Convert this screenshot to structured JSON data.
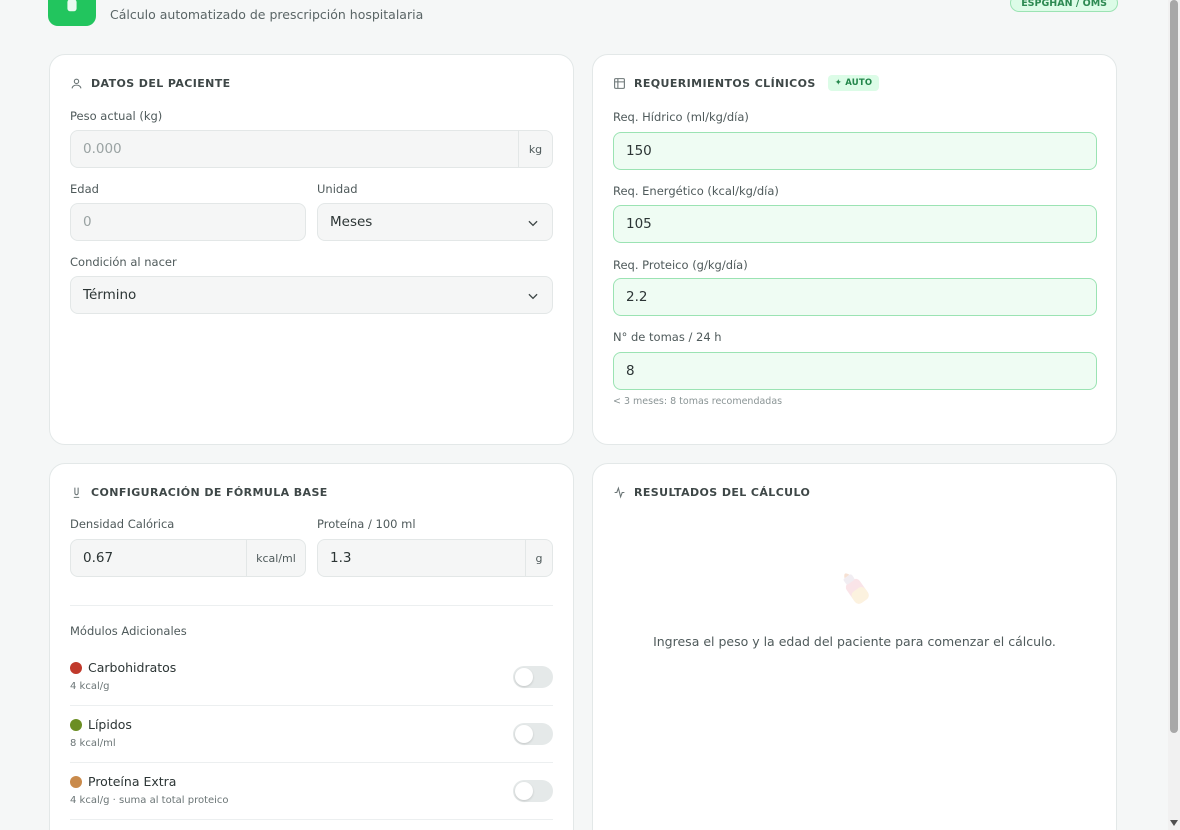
{
  "header": {
    "subtitle": "Cálculo automatizado de prescripción hospitalaria",
    "badge": "ESPGHAN / OMS"
  },
  "patient": {
    "title": "DATOS DEL PACIENTE",
    "weight_label": "Peso actual (kg)",
    "weight_placeholder": "0.000",
    "weight_unit": "kg",
    "age_label": "Edad",
    "age_placeholder": "0",
    "unit_label": "Unidad",
    "unit_value": "Meses",
    "birth_label": "Condición al nacer",
    "birth_value": "Término"
  },
  "requirements": {
    "title": "REQUERIMIENTOS CLÍNICOS",
    "auto_badge": "✦ AUTO",
    "hydric_label": "Req. Hídrico (ml/kg/día)",
    "hydric_value": "150",
    "energy_label": "Req. Energético (kcal/kg/día)",
    "energy_value": "105",
    "protein_label": "Req. Proteico (g/kg/día)",
    "protein_value": "2.2",
    "feeds_label": "N° de tomas / 24 h",
    "feeds_value": "8",
    "feeds_hint": "< 3 meses: 8 tomas recomendadas"
  },
  "formula": {
    "title": "CONFIGURACIÓN DE FÓRMULA BASE",
    "density_label": "Densidad Calórica",
    "density_value": "0.67",
    "density_unit": "kcal/ml",
    "protein_label": "Proteína / 100 ml",
    "protein_value": "1.3",
    "protein_unit": "g",
    "modules_label": "Módulos Adicionales",
    "modules": [
      {
        "name": "Carbohidratos",
        "sub": "4 kcal/g",
        "color": "#c0392b",
        "enabled": false
      },
      {
        "name": "Lípidos",
        "sub": "8 kcal/ml",
        "color": "#6b8e23",
        "enabled": false
      },
      {
        "name": "Proteína Extra",
        "sub": "4 kcal/g · suma al total proteico",
        "color": "#c98a4b",
        "enabled": false
      }
    ]
  },
  "results": {
    "title": "RESULTADOS DEL CÁLCULO",
    "empty_message": "Ingresa el peso y la edad del paciente para comenzar el cálculo."
  },
  "colors": {
    "accent": "#22c55e",
    "background": "#f5f7f7"
  }
}
